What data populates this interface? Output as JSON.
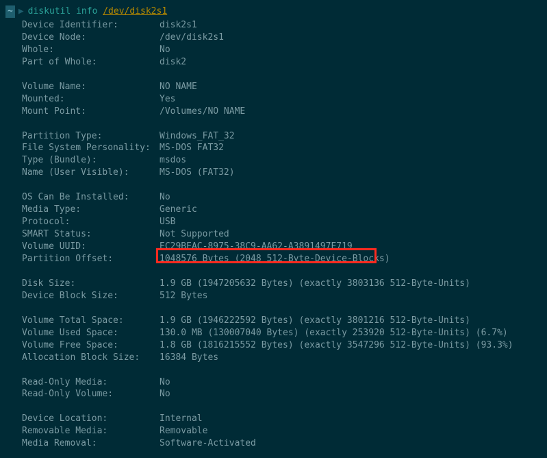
{
  "prompt": {
    "cwd": "~",
    "command": "diskutil info",
    "arg": "/dev/disk2s1"
  },
  "sections": [
    [
      {
        "label": "Device Identifier:",
        "value": "disk2s1"
      },
      {
        "label": "Device Node:",
        "value": "/dev/disk2s1"
      },
      {
        "label": "Whole:",
        "value": "No"
      },
      {
        "label": "Part of Whole:",
        "value": "disk2"
      }
    ],
    [
      {
        "label": "Volume Name:",
        "value": "NO NAME"
      },
      {
        "label": "Mounted:",
        "value": "Yes"
      },
      {
        "label": "Mount Point:",
        "value": "/Volumes/NO NAME"
      }
    ],
    [
      {
        "label": "Partition Type:",
        "value": "Windows_FAT_32"
      },
      {
        "label": "File System Personality:",
        "value": "MS-DOS FAT32"
      },
      {
        "label": "Type (Bundle):",
        "value": "msdos"
      },
      {
        "label": "Name (User Visible):",
        "value": "MS-DOS (FAT32)"
      }
    ],
    [
      {
        "label": "OS Can Be Installed:",
        "value": "No"
      },
      {
        "label": "Media Type:",
        "value": "Generic"
      },
      {
        "label": "Protocol:",
        "value": "USB"
      },
      {
        "label": "SMART Status:",
        "value": "Not Supported"
      },
      {
        "label": "Volume UUID:",
        "value": "EC29BEAC-8975-38C9-AA62-A3891497E719"
      },
      {
        "label": "Partition Offset:",
        "value": "1048576 Bytes (2048 512-Byte-Device-Blocks)"
      }
    ],
    [
      {
        "label": "Disk Size:",
        "value": "1.9 GB (1947205632 Bytes) (exactly 3803136 512-Byte-Units)"
      },
      {
        "label": "Device Block Size:",
        "value": "512 Bytes"
      }
    ],
    [
      {
        "label": "Volume Total Space:",
        "value": "1.9 GB (1946222592 Bytes) (exactly 3801216 512-Byte-Units)"
      },
      {
        "label": "Volume Used Space:",
        "value": "130.0 MB (130007040 Bytes) (exactly 253920 512-Byte-Units) (6.7%)"
      },
      {
        "label": "Volume Free Space:",
        "value": "1.8 GB (1816215552 Bytes) (exactly 3547296 512-Byte-Units) (93.3%)"
      },
      {
        "label": "Allocation Block Size:",
        "value": "16384 Bytes"
      }
    ],
    [
      {
        "label": "Read-Only Media:",
        "value": "No"
      },
      {
        "label": "Read-Only Volume:",
        "value": "No"
      }
    ],
    [
      {
        "label": "Device Location:",
        "value": "Internal"
      },
      {
        "label": "Removable Media:",
        "value": "Removable"
      },
      {
        "label": "Media Removal:",
        "value": "Software-Activated"
      }
    ]
  ]
}
